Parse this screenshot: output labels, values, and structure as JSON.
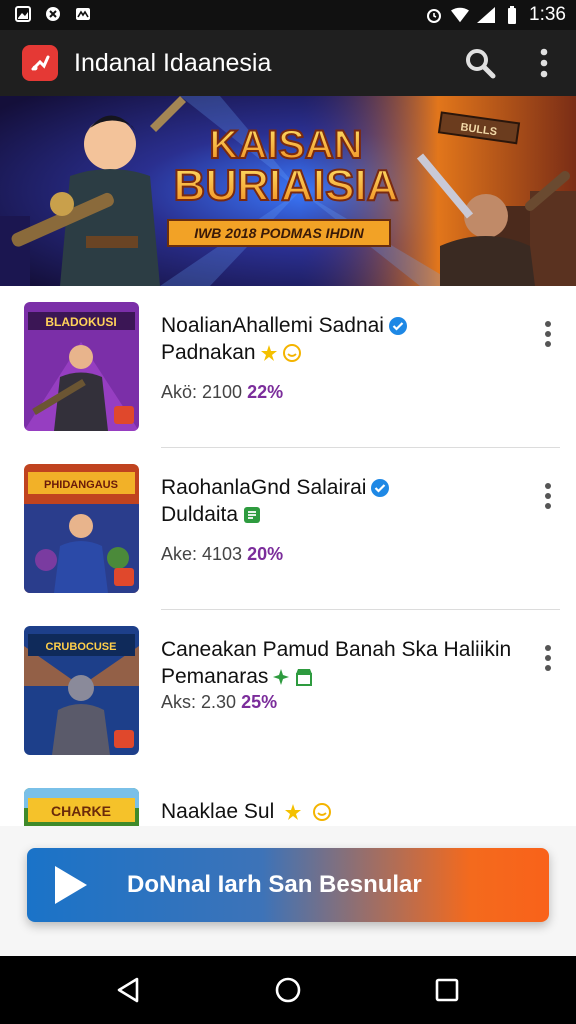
{
  "status_bar": {
    "time": "1:36",
    "icons": [
      "gallery-icon",
      "app-icon",
      "mail-icon",
      "alarm-icon",
      "wifi-icon",
      "signal-icon",
      "battery-icon"
    ]
  },
  "app_bar": {
    "title": "Indanal Idaanesia",
    "logo_color": "#e53935"
  },
  "banner": {
    "headline_1": "KAISAN",
    "headline_2": "BURIAISIA",
    "tagline": "IWB 2018 PODMAS IHDIN",
    "right_sign": "BULLS"
  },
  "games": [
    {
      "thumb_label": "BLADOKUSI",
      "thumb_bg": "#7b2fa8",
      "title": "NoalianAhallemi Sadnai",
      "subtitle": "Padnakan",
      "verified": true,
      "badge_icons": [
        "star-icon",
        "emoji-icon"
      ],
      "meta_label": "Akö: 2100",
      "meta_pct": "22%"
    },
    {
      "thumb_label": "PHIDANGAUS",
      "thumb_bg": "#c0431f",
      "title": "RaohanlaGnd Salairai",
      "subtitle": "Duldaita",
      "verified": true,
      "badge_icons": [
        "document-icon"
      ],
      "meta_label": "Ake: 4103",
      "meta_pct": "20%"
    },
    {
      "thumb_label": "CRUBOCUSE",
      "thumb_bg": "#1d3f8a",
      "title": "Caneakan Pamud Banah Ska Haliikin",
      "subtitle": "Pemanaras",
      "verified": false,
      "badge_icons": [
        "sparkle-icon",
        "shop-icon"
      ],
      "meta_label": "Aks: 2.30",
      "meta_pct": "25%"
    },
    {
      "thumb_label": "CHARKE",
      "thumb_bg": "#3f8a2a",
      "title": "Naaklae Sul",
      "subtitle": "",
      "verified": false,
      "badge_icons": [
        "star-icon",
        "emoji-icon"
      ],
      "meta_label": "",
      "meta_pct": ""
    }
  ],
  "cta": {
    "label": "DoNnal Iarh San Besnular"
  },
  "nav_bar": {
    "icons": [
      "back-icon",
      "home-icon",
      "recents-icon"
    ]
  },
  "colors": {
    "accent_purple": "#7b2d9b",
    "verified_blue": "#1e88e5",
    "cta_start": "#1a73c8",
    "cta_end": "#f9621a"
  }
}
